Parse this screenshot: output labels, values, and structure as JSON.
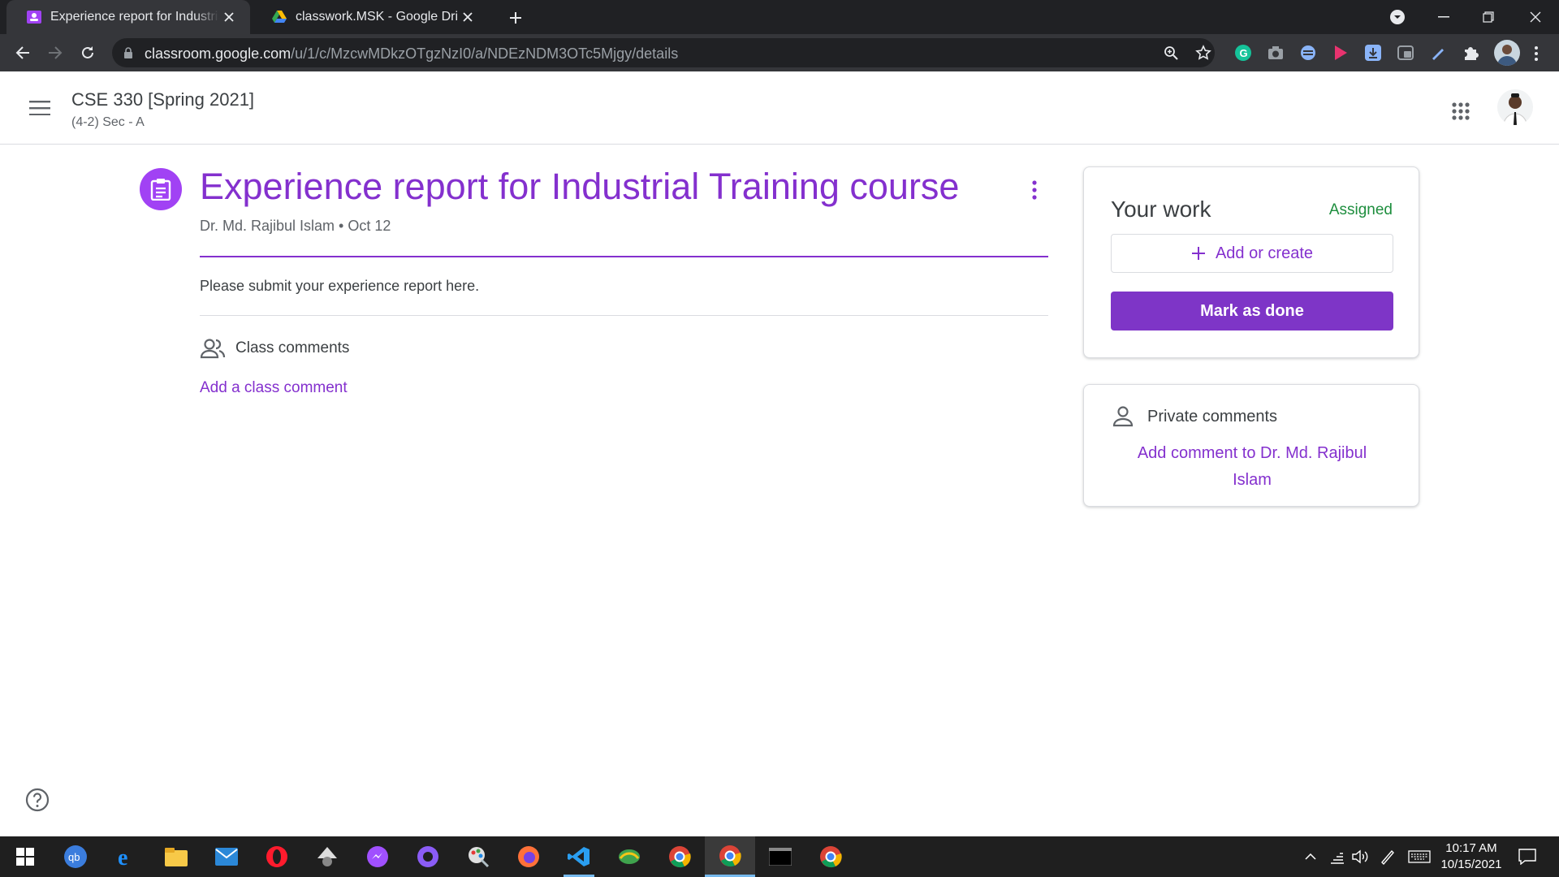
{
  "browser": {
    "tabs": [
      {
        "title": "Experience report for Industrial Tr",
        "active": true
      },
      {
        "title": "classwork.MSK - Google Drive",
        "active": false
      }
    ],
    "url_host": "classroom.google.com",
    "url_path": "/u/1/c/MzcwMDkzOTgzNzI0/a/NDEzNDM3OTc5Mjgy/details"
  },
  "header": {
    "class_name": "CSE 330 [Spring 2021]",
    "section": "(4-2) Sec - A"
  },
  "assignment": {
    "title": "Experience report for Industrial Training course",
    "meta": "Dr. Md. Rajibul Islam • Oct 12",
    "instructions": "Please submit your experience report here.",
    "class_comments_label": "Class comments",
    "add_class_comment": "Add a class comment"
  },
  "your_work": {
    "title": "Your work",
    "status": "Assigned",
    "add_create": "Add or create",
    "mark_done": "Mark as done"
  },
  "private_comments": {
    "label": "Private comments",
    "add": "Add comment to Dr. Md. Rajibul Islam"
  },
  "taskbar": {
    "time": "10:17 AM",
    "date": "10/15/2021"
  },
  "colors": {
    "accent_purple": "#8430ce",
    "status_green": "#1e8e3e",
    "button_purple": "#7e35c7"
  }
}
